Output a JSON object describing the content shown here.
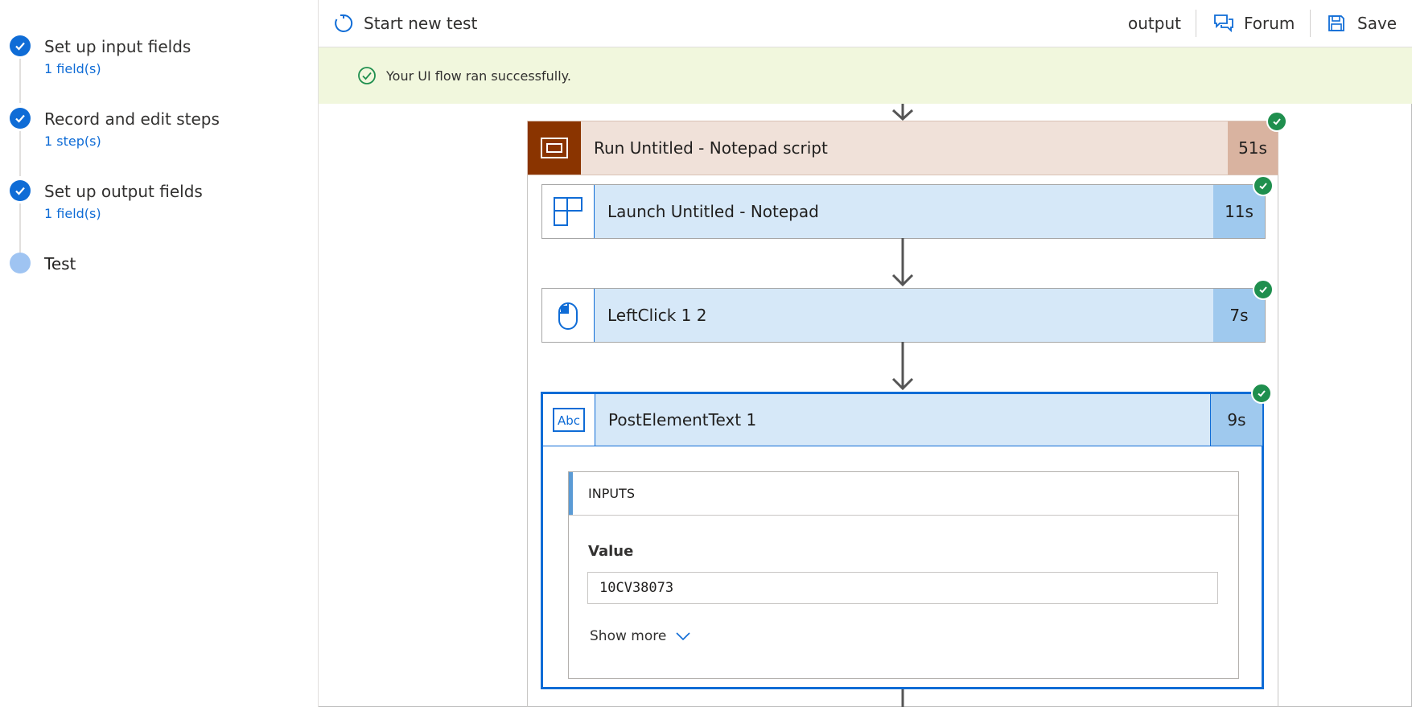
{
  "sidebar": {
    "steps": [
      {
        "title": "Set up input fields",
        "sub": "1 field(s)",
        "status": "complete"
      },
      {
        "title": "Record and edit steps",
        "sub": "1 step(s)",
        "status": "complete"
      },
      {
        "title": "Set up output fields",
        "sub": "1 field(s)",
        "status": "complete"
      },
      {
        "title": "Test",
        "sub": "",
        "status": "current"
      }
    ]
  },
  "toolbar": {
    "start_new_test": "Start new test",
    "output": "output",
    "forum": "Forum",
    "save": "Save"
  },
  "banner": {
    "message": "Your UI flow ran successfully."
  },
  "flow": {
    "run": {
      "label": "Run Untitled - Notepad script",
      "duration": "51s"
    },
    "steps": [
      {
        "label": "Launch Untitled - Notepad",
        "duration": "11s",
        "icon": "app-window-icon"
      },
      {
        "label": "LeftClick 1 2",
        "duration": "7s",
        "icon": "mouse-icon"
      },
      {
        "label": "PostElementText 1",
        "duration": "9s",
        "icon": "abc-text-icon"
      }
    ],
    "details": {
      "section_title": "INPUTS",
      "value_label": "Value",
      "value": "10CV38073",
      "show_more": "Show more"
    }
  },
  "colors": {
    "accent": "#0f6cd6",
    "success": "#1f8f4e",
    "run_header_bg": "#f0e1d9",
    "run_icon_bg": "#8a3400",
    "run_duration_bg": "#d9b3a0",
    "step_bg": "#d6e8f8",
    "step_duration_bg": "#9fc9ee",
    "banner_bg": "#f1f7dd"
  }
}
